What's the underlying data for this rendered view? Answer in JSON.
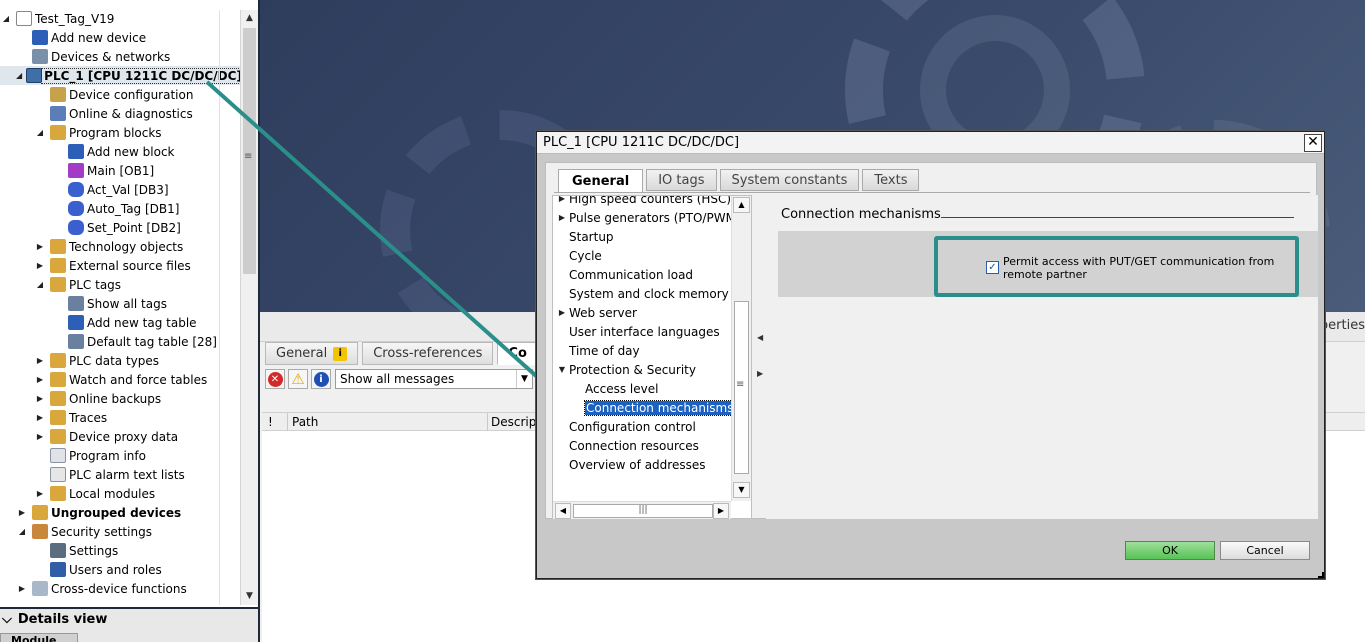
{
  "project_tree": {
    "items": [
      {
        "label": "Test_Tag_V19",
        "icon": "project-icon",
        "expander": "expanded",
        "indent": 0
      },
      {
        "label": "Add new device",
        "icon": "add-device-icon",
        "expander": "none",
        "indent": 1
      },
      {
        "label": "Devices & networks",
        "icon": "network-icon",
        "expander": "none",
        "indent": 1
      },
      {
        "label": "PLC_1 [CPU 1211C DC/DC/DC]",
        "icon": "plc-icon",
        "expander": "expanded",
        "indent": 1,
        "selected": true
      },
      {
        "label": "Device configuration",
        "icon": "device-config-icon",
        "expander": "none",
        "indent": 2
      },
      {
        "label": "Online & diagnostics",
        "icon": "diagnostics-icon",
        "expander": "none",
        "indent": 2
      },
      {
        "label": "Program blocks",
        "icon": "folder-icon",
        "expander": "expanded",
        "indent": 2
      },
      {
        "label": "Add new block",
        "icon": "add-block-icon",
        "expander": "none",
        "indent": 3
      },
      {
        "label": "Main [OB1]",
        "icon": "ob-icon",
        "expander": "none",
        "indent": 3
      },
      {
        "label": "Act_Val [DB3]",
        "icon": "db-icon",
        "expander": "none",
        "indent": 3
      },
      {
        "label": "Auto_Tag [DB1]",
        "icon": "db-icon",
        "expander": "none",
        "indent": 3
      },
      {
        "label": "Set_Point [DB2]",
        "icon": "db-icon",
        "expander": "none",
        "indent": 3
      },
      {
        "label": "Technology objects",
        "icon": "folder-icon",
        "expander": "collapsed",
        "indent": 2
      },
      {
        "label": "External source files",
        "icon": "folder-icon",
        "expander": "collapsed",
        "indent": 2
      },
      {
        "label": "PLC tags",
        "icon": "folder-icon",
        "expander": "expanded",
        "indent": 2
      },
      {
        "label": "Show all tags",
        "icon": "tag-table-icon",
        "expander": "none",
        "indent": 3
      },
      {
        "label": "Add new tag table",
        "icon": "add-tag-table-icon",
        "expander": "none",
        "indent": 3
      },
      {
        "label": "Default tag table [28]",
        "icon": "tag-table-icon",
        "expander": "none",
        "indent": 3
      },
      {
        "label": "PLC data types",
        "icon": "folder-icon",
        "expander": "collapsed",
        "indent": 2
      },
      {
        "label": "Watch and force tables",
        "icon": "folder-icon",
        "expander": "collapsed",
        "indent": 2
      },
      {
        "label": "Online backups",
        "icon": "folder-icon",
        "expander": "collapsed",
        "indent": 2
      },
      {
        "label": "Traces",
        "icon": "folder-icon",
        "expander": "collapsed",
        "indent": 2
      },
      {
        "label": "Device proxy data",
        "icon": "folder-icon",
        "expander": "collapsed",
        "indent": 2
      },
      {
        "label": "Program info",
        "icon": "program-info-icon",
        "expander": "none",
        "indent": 2
      },
      {
        "label": "PLC alarm text lists",
        "icon": "alarm-list-icon",
        "expander": "none",
        "indent": 2
      },
      {
        "label": "Local modules",
        "icon": "folder-icon",
        "expander": "collapsed",
        "indent": 2
      },
      {
        "label": "Ungrouped devices",
        "icon": "folder-icon",
        "expander": "collapsed",
        "indent": 1,
        "bold": true
      },
      {
        "label": "Security settings",
        "icon": "security-icon",
        "expander": "expanded",
        "indent": 1
      },
      {
        "label": "Settings",
        "icon": "settings-icon",
        "expander": "none",
        "indent": 2
      },
      {
        "label": "Users and roles",
        "icon": "users-icon",
        "expander": "none",
        "indent": 2
      },
      {
        "label": "Cross-device functions",
        "icon": "cross-device-icon",
        "expander": "collapsed",
        "indent": 1
      }
    ]
  },
  "details_view": {
    "title": "Details view",
    "tab": "Module"
  },
  "lower_panel": {
    "properties_label": "operties"
  },
  "inspector": {
    "tabs": [
      {
        "label": "General",
        "badge": "i"
      },
      {
        "label": "Cross-references"
      },
      {
        "label": "Co"
      }
    ],
    "filter": "Show all messages",
    "columns": [
      "!",
      "Path",
      "Descript"
    ]
  },
  "dialog": {
    "title": "PLC_1 [CPU 1211C DC/DC/DC]",
    "close": "✕",
    "tabs": [
      "General",
      "IO tags",
      "System constants",
      "Texts"
    ],
    "nav_items": [
      {
        "label": "High speed counters (HSC)",
        "expander": "collapsed",
        "indent": 0
      },
      {
        "label": "Pulse generators (PTO/PWM)",
        "expander": "collapsed",
        "indent": 0
      },
      {
        "label": "Startup",
        "expander": "none",
        "indent": 0
      },
      {
        "label": "Cycle",
        "expander": "none",
        "indent": 0
      },
      {
        "label": "Communication load",
        "expander": "none",
        "indent": 0
      },
      {
        "label": "System and clock memory",
        "expander": "none",
        "indent": 0
      },
      {
        "label": "Web server",
        "expander": "collapsed",
        "indent": 0
      },
      {
        "label": "User interface languages",
        "expander": "none",
        "indent": 0
      },
      {
        "label": "Time of day",
        "expander": "none",
        "indent": 0
      },
      {
        "label": "Protection & Security",
        "expander": "expanded",
        "indent": 0
      },
      {
        "label": "Access level",
        "expander": "none",
        "indent": 1
      },
      {
        "label": "Connection mechanisms",
        "expander": "none",
        "indent": 1,
        "selected": true
      },
      {
        "label": "Configuration control",
        "expander": "none",
        "indent": 0
      },
      {
        "label": "Connection resources",
        "expander": "none",
        "indent": 0
      },
      {
        "label": "Overview of addresses",
        "expander": "none",
        "indent": 0
      }
    ],
    "section_title": "Connection mechanisms",
    "permit_checkbox": {
      "label": "Permit access with PUT/GET communication from remote partner",
      "checked": true
    },
    "ok": "OK",
    "cancel": "Cancel"
  },
  "colors": {
    "highlight": "#2a8f8a",
    "ok_green": "#58c257",
    "selection_blue": "#1c62c1"
  }
}
